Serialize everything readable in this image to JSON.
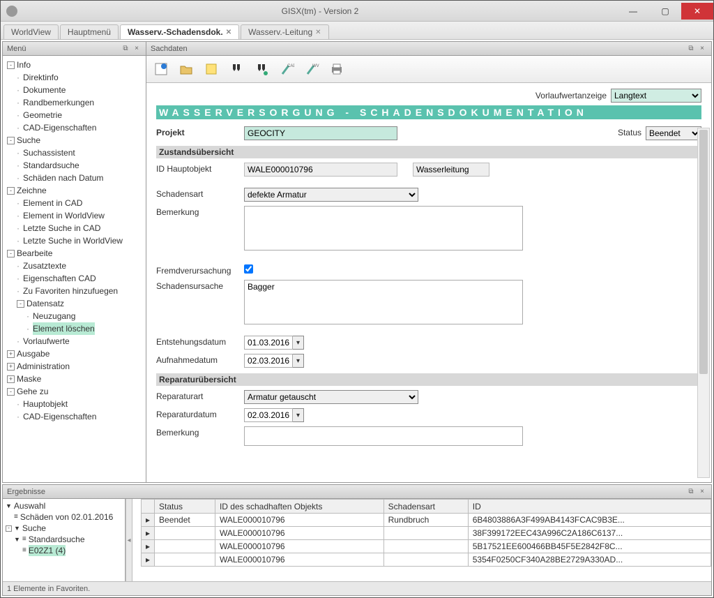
{
  "window": {
    "title": "GISX(tm) - Version 2"
  },
  "tabs": [
    {
      "label": "WorldView",
      "closable": false,
      "active": false
    },
    {
      "label": "Hauptmenü",
      "closable": false,
      "active": false
    },
    {
      "label": "Wasserv.-Schadensdok.",
      "closable": true,
      "active": true
    },
    {
      "label": "Wasserv.-Leitung",
      "closable": true,
      "active": false
    }
  ],
  "sidebar": {
    "title": "Menü",
    "info": {
      "label": "Info",
      "items": [
        "Direktinfo",
        "Dokumente",
        "Randbemerkungen",
        "Geometrie",
        "CAD-Eigenschaften"
      ]
    },
    "suche": {
      "label": "Suche",
      "items": [
        "Suchassistent",
        "Standardsuche",
        "Schäden nach Datum"
      ]
    },
    "zeichne": {
      "label": "Zeichne",
      "items": [
        "Element in CAD",
        "Element in WorldView",
        "Letzte Suche in CAD",
        "Letzte Suche in WorldView"
      ]
    },
    "bearbeite": {
      "label": "Bearbeite",
      "items": [
        "Zusatztexte",
        "Eigenschaften CAD",
        "Zu Favoriten hinzufuegen"
      ],
      "datensatz": {
        "label": "Datensatz",
        "items": [
          "Neuzugang",
          "Element löschen"
        ],
        "selectedIndex": 1
      },
      "after": [
        "Vorlaufwerte"
      ]
    },
    "ausgabe": {
      "label": "Ausgabe"
    },
    "administration": {
      "label": "Administration"
    },
    "maske": {
      "label": "Maske"
    },
    "geheZu": {
      "label": "Gehe zu",
      "items": [
        "Hauptobjekt",
        "CAD-Eigenschaften"
      ]
    }
  },
  "sachdaten": {
    "title": "Sachdaten",
    "vorlauf_label": "Vorlaufwertanzeige",
    "vorlauf_value": "Langtext",
    "banner": "WASSERVERSORGUNG - SCHADENSDOKUMENTATION",
    "projekt_label": "Projekt",
    "projekt_value": "GEOCITY",
    "status_label": "Status",
    "status_value": "Beendet",
    "zustand_header": "Zustandsübersicht",
    "id_haupt_label": "ID Hauptobjekt",
    "id_haupt_value": "WALE000010796",
    "id_haupt_type": "Wasserleitung",
    "schadensart_label": "Schadensart",
    "schadensart_value": "defekte Armatur",
    "bemerkung_label": "Bemerkung",
    "bemerkung_value": "",
    "fremd_label": "Fremdverursachung",
    "fremd_checked": true,
    "ursache_label": "Schadensursache",
    "ursache_value": "Bagger",
    "entsteh_label": "Entstehungsdatum",
    "entsteh_value": "01.03.2016",
    "aufnahm_label": "Aufnahmedatum",
    "aufnahm_value": "02.03.2016",
    "reparatur_header": "Reparaturübersicht",
    "repart_label": "Reparaturart",
    "repart_value": "Armatur getauscht",
    "repdate_label": "Reparaturdatum",
    "repdate_value": "02.03.2016",
    "repbem_label": "Bemerkung",
    "repbem_value": ""
  },
  "results": {
    "title": "Ergebnisse",
    "tree": {
      "auswahl": "Auswahl",
      "auswahl_child": "Schäden von 02.01.2016",
      "suche": "Suche",
      "standard": "Standardsuche",
      "leaf": "E02Z1 (4)"
    },
    "columns": [
      "Status",
      "ID des schadhaften Objekts",
      "Schadensart",
      "ID"
    ],
    "rows": [
      {
        "status": "Beendet",
        "obj": "WALE000010796",
        "art": "Rundbruch",
        "id": "6B4803886A3F499AB4143FCAC9B3E..."
      },
      {
        "status": "",
        "obj": "WALE000010796",
        "art": "",
        "id": "38F399172EEC43A996C2A186C6137..."
      },
      {
        "status": "",
        "obj": "WALE000010796",
        "art": "",
        "id": "5B17521EE600466BB45F5E2842F8C..."
      },
      {
        "status": "",
        "obj": "WALE000010796",
        "art": "",
        "id": "5354F0250CF340A28BE2729A330AD..."
      }
    ]
  },
  "statusbar": "1 Elemente in Favoriten."
}
